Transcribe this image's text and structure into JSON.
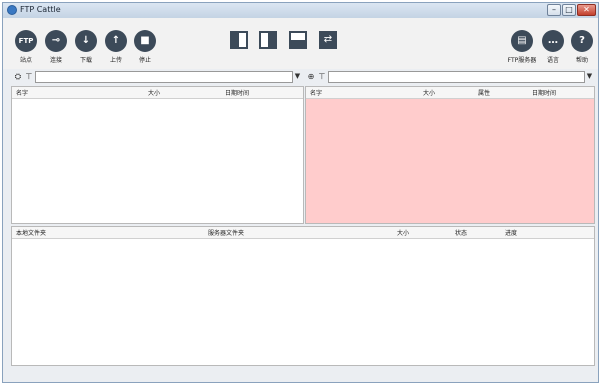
{
  "app": {
    "title": "FTP Cattle"
  },
  "window_controls": {
    "minimize": "–",
    "maximize": "□",
    "close": "✕"
  },
  "toolbar": {
    "left_buttons": [
      {
        "icon_text": "FTP",
        "label": "站点"
      },
      {
        "icon_text": "⊸",
        "label": "连接"
      },
      {
        "icon_text": "↓",
        "label": "下载"
      },
      {
        "icon_text": "↑",
        "label": "上传"
      },
      {
        "icon_text": "■",
        "label": "停止"
      }
    ],
    "right_buttons": [
      {
        "icon_text": "▤",
        "label": "FTP服务器"
      },
      {
        "icon_text": "…",
        "label": "语言"
      },
      {
        "icon_text": "?",
        "label": "帮助"
      }
    ],
    "swap_glyph": "⇄"
  },
  "path_bars": {
    "local": {
      "icon": "⛭",
      "tree_icon": "⊤",
      "value": "",
      "dropdown": "▼"
    },
    "remote": {
      "icon": "⊕",
      "tree_icon": "⊤",
      "value": "",
      "dropdown": "▼"
    }
  },
  "local_pane": {
    "columns": [
      "名字",
      "大小",
      "日期时间"
    ]
  },
  "remote_pane": {
    "columns": [
      "名字",
      "大小",
      "属性",
      "日期时间"
    ],
    "background": "#ffcccc"
  },
  "queue_pane": {
    "columns": [
      "本地文件夹",
      "服务器文件夹",
      "大小",
      "状态",
      "进度"
    ]
  }
}
